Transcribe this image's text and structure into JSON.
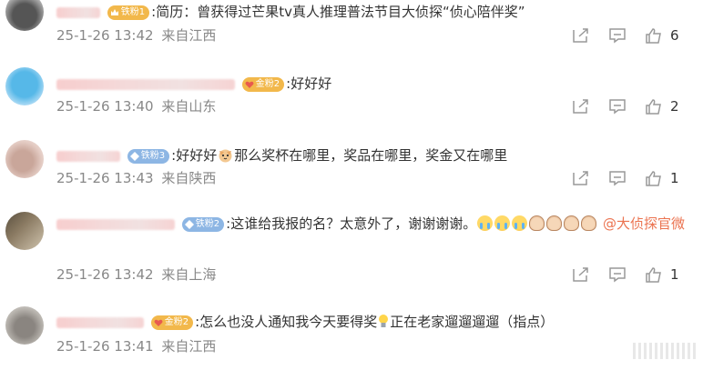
{
  "comments": [
    {
      "badge": {
        "type": "iron",
        "label": "铁粉1"
      },
      "text": ":简历：曾获得过芒果tv真人推理普法节目大侦探“侦心陪伴奖”",
      "time": "25-1-26 13:42",
      "location": "来自江西",
      "likes": "6"
    },
    {
      "badge": {
        "type": "gold",
        "label": "金粉2"
      },
      "text": ":好好好",
      "time": "25-1-26 13:40",
      "location": "来自山东",
      "likes": "2"
    },
    {
      "badge": {
        "type": "iron",
        "label": "铁粉3"
      },
      "text_before": ":好好好",
      "text_after": "那么奖杯在哪里，奖品在哪里，奖金又在哪里",
      "time": "25-1-26 13:43",
      "location": "来自陕西",
      "likes": "1"
    },
    {
      "badge": {
        "type": "iron",
        "label": "铁粉2"
      },
      "text": ":这谁给我报的名？太意外了，谢谢谢谢。",
      "mention": "@大侦探官微",
      "time": "25-1-26 13:42",
      "location": "来自上海",
      "likes": "1"
    },
    {
      "badge": {
        "type": "gold",
        "label": "金粉2"
      },
      "text_before": ":怎么也没人通知我今天要得奖",
      "text_after": "正在老家遛遛遛遛（指点）",
      "time": "25-1-26 13:41",
      "location": "来自江西"
    }
  ],
  "colors": {
    "accent": "#eb7350",
    "meta": "#888888",
    "iron_badge": "#8db6e4",
    "gold_badge": "#f2b84b"
  },
  "icons": [
    "share-icon",
    "comment-icon",
    "thumbs-up-icon"
  ]
}
